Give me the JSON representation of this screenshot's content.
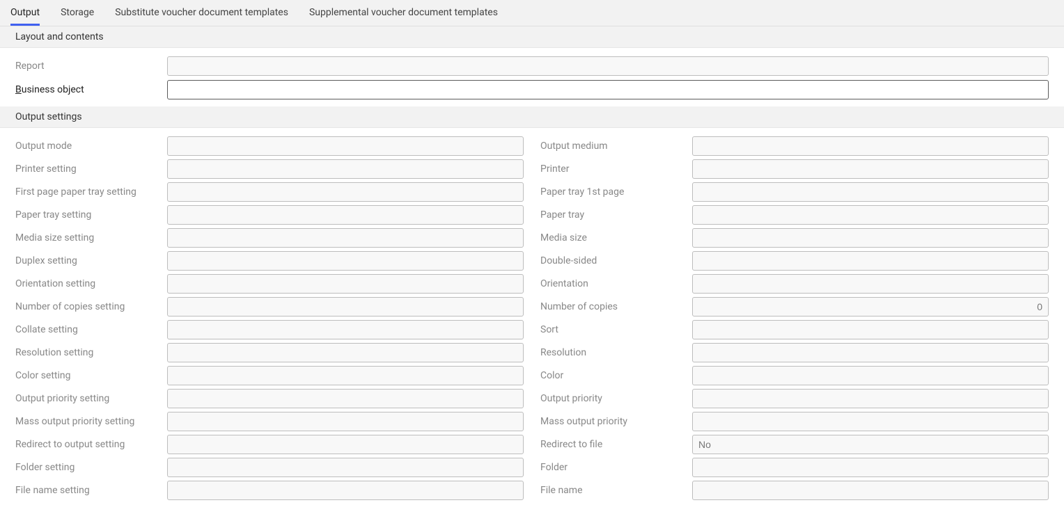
{
  "tabs": {
    "output": "Output",
    "storage": "Storage",
    "substitute": "Substitute voucher document templates",
    "supplemental": "Supplemental voucher document templates"
  },
  "sections": {
    "layout": "Layout and contents",
    "output_settings": "Output settings"
  },
  "layout_fields": {
    "report": {
      "label": "Report",
      "value": ""
    },
    "business_object": {
      "label_prefix": "B",
      "label_rest": "usiness object",
      "value": ""
    }
  },
  "output_left": [
    {
      "label": "Output mode",
      "value": ""
    },
    {
      "label": "Printer setting",
      "value": ""
    },
    {
      "label": "First page paper tray setting",
      "value": ""
    },
    {
      "label": "Paper tray setting",
      "value": ""
    },
    {
      "label": "Media size setting",
      "value": ""
    },
    {
      "label": "Duplex setting",
      "value": ""
    },
    {
      "label": "Orientation setting",
      "value": ""
    },
    {
      "label": "Number of copies setting",
      "value": ""
    },
    {
      "label": "Collate setting",
      "value": ""
    },
    {
      "label": "Resolution setting",
      "value": ""
    },
    {
      "label": "Color setting",
      "value": ""
    },
    {
      "label": "Output priority setting",
      "value": ""
    },
    {
      "label": "Mass output priority setting",
      "value": ""
    },
    {
      "label": "Redirect to output setting",
      "value": ""
    },
    {
      "label": "Folder setting",
      "value": ""
    },
    {
      "label": "File name setting",
      "value": ""
    }
  ],
  "output_right": [
    {
      "label": "Output medium",
      "value": "",
      "align": "left"
    },
    {
      "label": "Printer",
      "value": "",
      "align": "left"
    },
    {
      "label": "Paper tray 1st page",
      "value": "",
      "align": "left"
    },
    {
      "label": "Paper tray",
      "value": "",
      "align": "left"
    },
    {
      "label": "Media size",
      "value": "",
      "align": "left"
    },
    {
      "label": "Double-sided",
      "value": "",
      "align": "left"
    },
    {
      "label": "Orientation",
      "value": "",
      "align": "left"
    },
    {
      "label": "Number of copies",
      "value": "0",
      "align": "right"
    },
    {
      "label": "Sort",
      "value": "",
      "align": "left"
    },
    {
      "label": "Resolution",
      "value": "",
      "align": "left"
    },
    {
      "label": "Color",
      "value": "",
      "align": "left"
    },
    {
      "label": "Output priority",
      "value": "",
      "align": "left"
    },
    {
      "label": "Mass output priority",
      "value": "",
      "align": "left"
    },
    {
      "label": "Redirect to file",
      "value": "No",
      "align": "left"
    },
    {
      "label": "Folder",
      "value": "",
      "align": "left"
    },
    {
      "label": "File name",
      "value": "",
      "align": "left"
    }
  ]
}
